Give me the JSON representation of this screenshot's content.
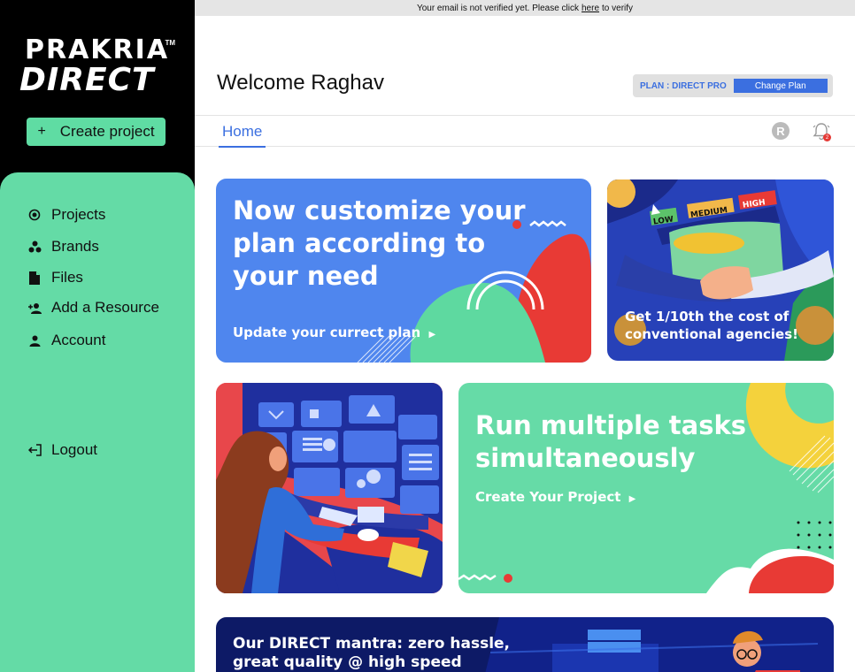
{
  "banner": {
    "prefix": "Your email is not verified yet. Please click",
    "link": "here",
    "suffix": "to verify"
  },
  "brand": {
    "line1": "PRAKRIA",
    "line2": "DIRECT",
    "tm": "TM"
  },
  "sidebar": {
    "create_label": "Create project",
    "items": [
      {
        "label": "Projects",
        "icon": "target-icon"
      },
      {
        "label": "Brands",
        "icon": "brands-icon"
      },
      {
        "label": "Files",
        "icon": "file-icon"
      },
      {
        "label": "Add a Resource",
        "icon": "add-user-icon"
      },
      {
        "label": "Account",
        "icon": "user-icon"
      }
    ],
    "logout_label": "Logout"
  },
  "header": {
    "welcome": "Welcome Raghav",
    "plan_label": "PLAN : DIRECT PRO",
    "change_plan": "Change Plan"
  },
  "tabs": {
    "home": "Home",
    "avatar_initial": "R",
    "notification_count": "2"
  },
  "cards": {
    "customize": {
      "title_line1": "Now customize your",
      "title_line2": "plan according to",
      "title_line3": "your need",
      "link": "Update your currect plan"
    },
    "cost": {
      "text_line1": "Get 1/10th the cost of",
      "text_line2": "conventional agencies!",
      "low": "LOW",
      "medium": "MEDIUM",
      "high": "HIGH"
    },
    "tasks": {
      "title_line1": "Run multiple tasks",
      "title_line2": "simultaneously",
      "link": "Create Your Project"
    },
    "mantra": {
      "line1": "Our DIRECT mantra: zero hassle,",
      "line2": "great quality @ high speed"
    }
  },
  "colors": {
    "accent_green": "#64dba6",
    "accent_blue": "#3b6fe0",
    "card_blue": "#4f86ee",
    "red": "#e8474b",
    "sidebar_bg": "#000000"
  }
}
